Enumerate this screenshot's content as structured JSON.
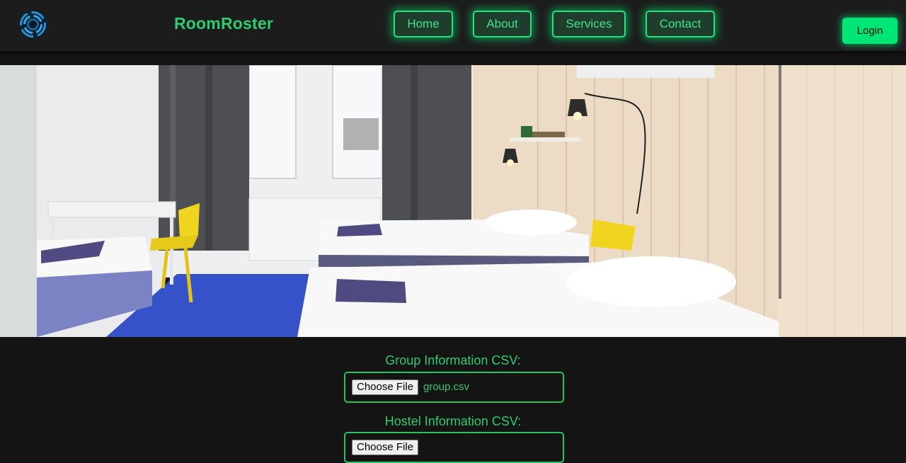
{
  "header": {
    "brand": "RoomRoster",
    "nav": [
      {
        "label": "Home"
      },
      {
        "label": "About"
      },
      {
        "label": "Services"
      },
      {
        "label": "Contact"
      }
    ],
    "login_label": "Login"
  },
  "icons": {
    "logo": "circular-swirl-logo-icon"
  },
  "hero": {
    "description": "hostel-room-photo"
  },
  "form": {
    "group_label": "Group Information CSV:",
    "group_button": "Choose File",
    "group_file": "group.csv",
    "hostel_label": "Hostel Information CSV:",
    "hostel_button": "Choose File"
  },
  "colors": {
    "accent": "#2ecc71",
    "glow": "#00e676",
    "background": "#141414",
    "header_bg": "#1c1c1c"
  }
}
